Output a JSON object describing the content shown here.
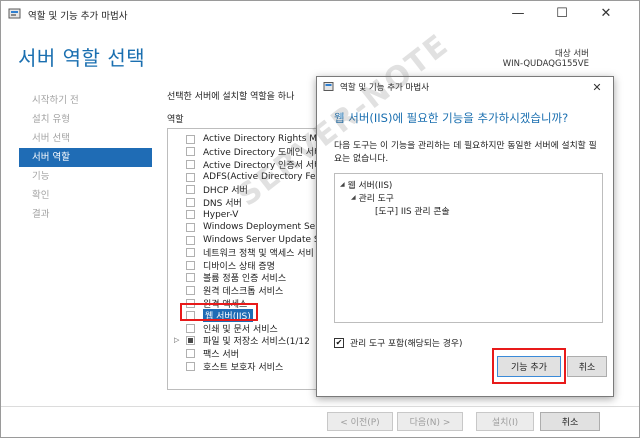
{
  "window": {
    "title": "역할 및 기능 추가 마법사",
    "minimize_glyph": "—",
    "maximize_glyph": "☐",
    "close_glyph": "✕"
  },
  "page_title": "서버 역할 선택",
  "destination": {
    "label": "대상 서버",
    "server": "WIN-QUDAQG155VE"
  },
  "steps": [
    {
      "label": "시작하기 전",
      "active": false
    },
    {
      "label": "설치 유형",
      "active": false
    },
    {
      "label": "서버 선택",
      "active": false
    },
    {
      "label": "서버 역할",
      "active": true
    },
    {
      "label": "기능",
      "active": false
    },
    {
      "label": "확인",
      "active": false
    },
    {
      "label": "결과",
      "active": false
    }
  ],
  "description": "선택한 서버에 설치할 역할을 하나",
  "roles_header": "역할",
  "roles": [
    {
      "label": "Active Directory Rights Ma",
      "state": "unchecked"
    },
    {
      "label": "Active Directory 도메인 서비",
      "state": "unchecked"
    },
    {
      "label": "Active Directory 인증서 서비",
      "state": "unchecked"
    },
    {
      "label": "ADFS(Active Directory Fede",
      "state": "unchecked"
    },
    {
      "label": "DHCP 서버",
      "state": "unchecked"
    },
    {
      "label": "DNS 서버",
      "state": "unchecked"
    },
    {
      "label": "Hyper-V",
      "state": "unchecked"
    },
    {
      "label": "Windows Deployment Serv",
      "state": "unchecked"
    },
    {
      "label": "Windows Server Update Se",
      "state": "unchecked"
    },
    {
      "label": "네트워크 정책 및 액세스 서비",
      "state": "unchecked"
    },
    {
      "label": "디바이스 상태 증명",
      "state": "unchecked"
    },
    {
      "label": "볼륨 정품 인증 서비스",
      "state": "unchecked"
    },
    {
      "label": "원격 데스크톱 서비스",
      "state": "unchecked"
    },
    {
      "label": "원격 액세스",
      "state": "unchecked"
    },
    {
      "label": "웹 서버(IIS)",
      "state": "unchecked",
      "selected": true
    },
    {
      "label": "인쇄 및 문서 서비스",
      "state": "unchecked"
    },
    {
      "label": "파일 및 저장소 서비스(1/12",
      "state": "partial",
      "expandable": true
    },
    {
      "label": "팩스 서버",
      "state": "unchecked"
    },
    {
      "label": "호스트 보호자 서비스",
      "state": "unchecked"
    }
  ],
  "buttons": {
    "prev": "< 이전(P)",
    "next": "다음(N) >",
    "install": "설치(I)",
    "cancel": "취소"
  },
  "dialog": {
    "title": "역할 및 기능 추가 마법사",
    "close_glyph": "✕",
    "question": "웹 서버(IIS)에 필요한 기능을 추가하시겠습니까?",
    "info": "다음 도구는 이 기능을 관리하는 데 필요하지만 동일한 서버에 설치할 필요는 없습니다.",
    "features": [
      {
        "label": "웹 서버(IIS)",
        "level": 0,
        "expanded": true
      },
      {
        "label": "관리 도구",
        "level": 1,
        "expanded": true
      },
      {
        "label": "[도구] IIS 관리 콘솔",
        "level": 2
      }
    ],
    "include_tools_label": "관리 도구 포함(해당되는 경우)",
    "include_tools_checked": true,
    "add_features_button": "기능 추가",
    "cancel_button": "취소"
  },
  "watermark": "SERVER-NOTE"
}
